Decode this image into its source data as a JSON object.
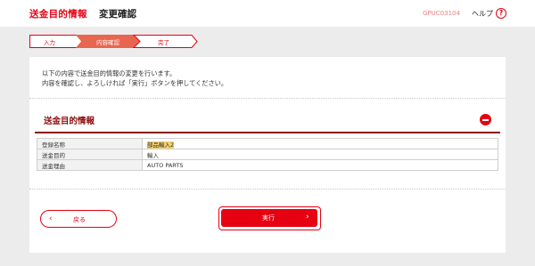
{
  "header": {
    "title": "送金目的情報",
    "subtitle": "変更確認",
    "screen_code": "GPUC03104",
    "help_label": "ヘルプ",
    "help_icon": "?"
  },
  "steps": [
    {
      "label": "入力",
      "state": "done"
    },
    {
      "label": "内容確認",
      "state": "current"
    },
    {
      "label": "完了",
      "state": "todo"
    }
  ],
  "intro": {
    "line1": "以下の内容で送金目的情報の変更を行います。",
    "line2": "内容を確認し、よろしければ「実行」ボタンを押してください。"
  },
  "section": {
    "title": "送金目的情報",
    "collapse_icon": "minus-circle-icon",
    "rows": [
      {
        "key": "登録名称",
        "value": "部品輸入2"
      },
      {
        "key": "送金目的",
        "value": "輸入"
      },
      {
        "key": "送金理由",
        "value": "AUTO PARTS"
      }
    ]
  },
  "buttons": {
    "back_label": "戻る",
    "back_icon": "‹",
    "execute_label": "実行",
    "execute_icon": "›"
  },
  "colors": {
    "accent": "#e60012",
    "section_title": "#8a0d0d",
    "highlight": "#f6d16b"
  }
}
